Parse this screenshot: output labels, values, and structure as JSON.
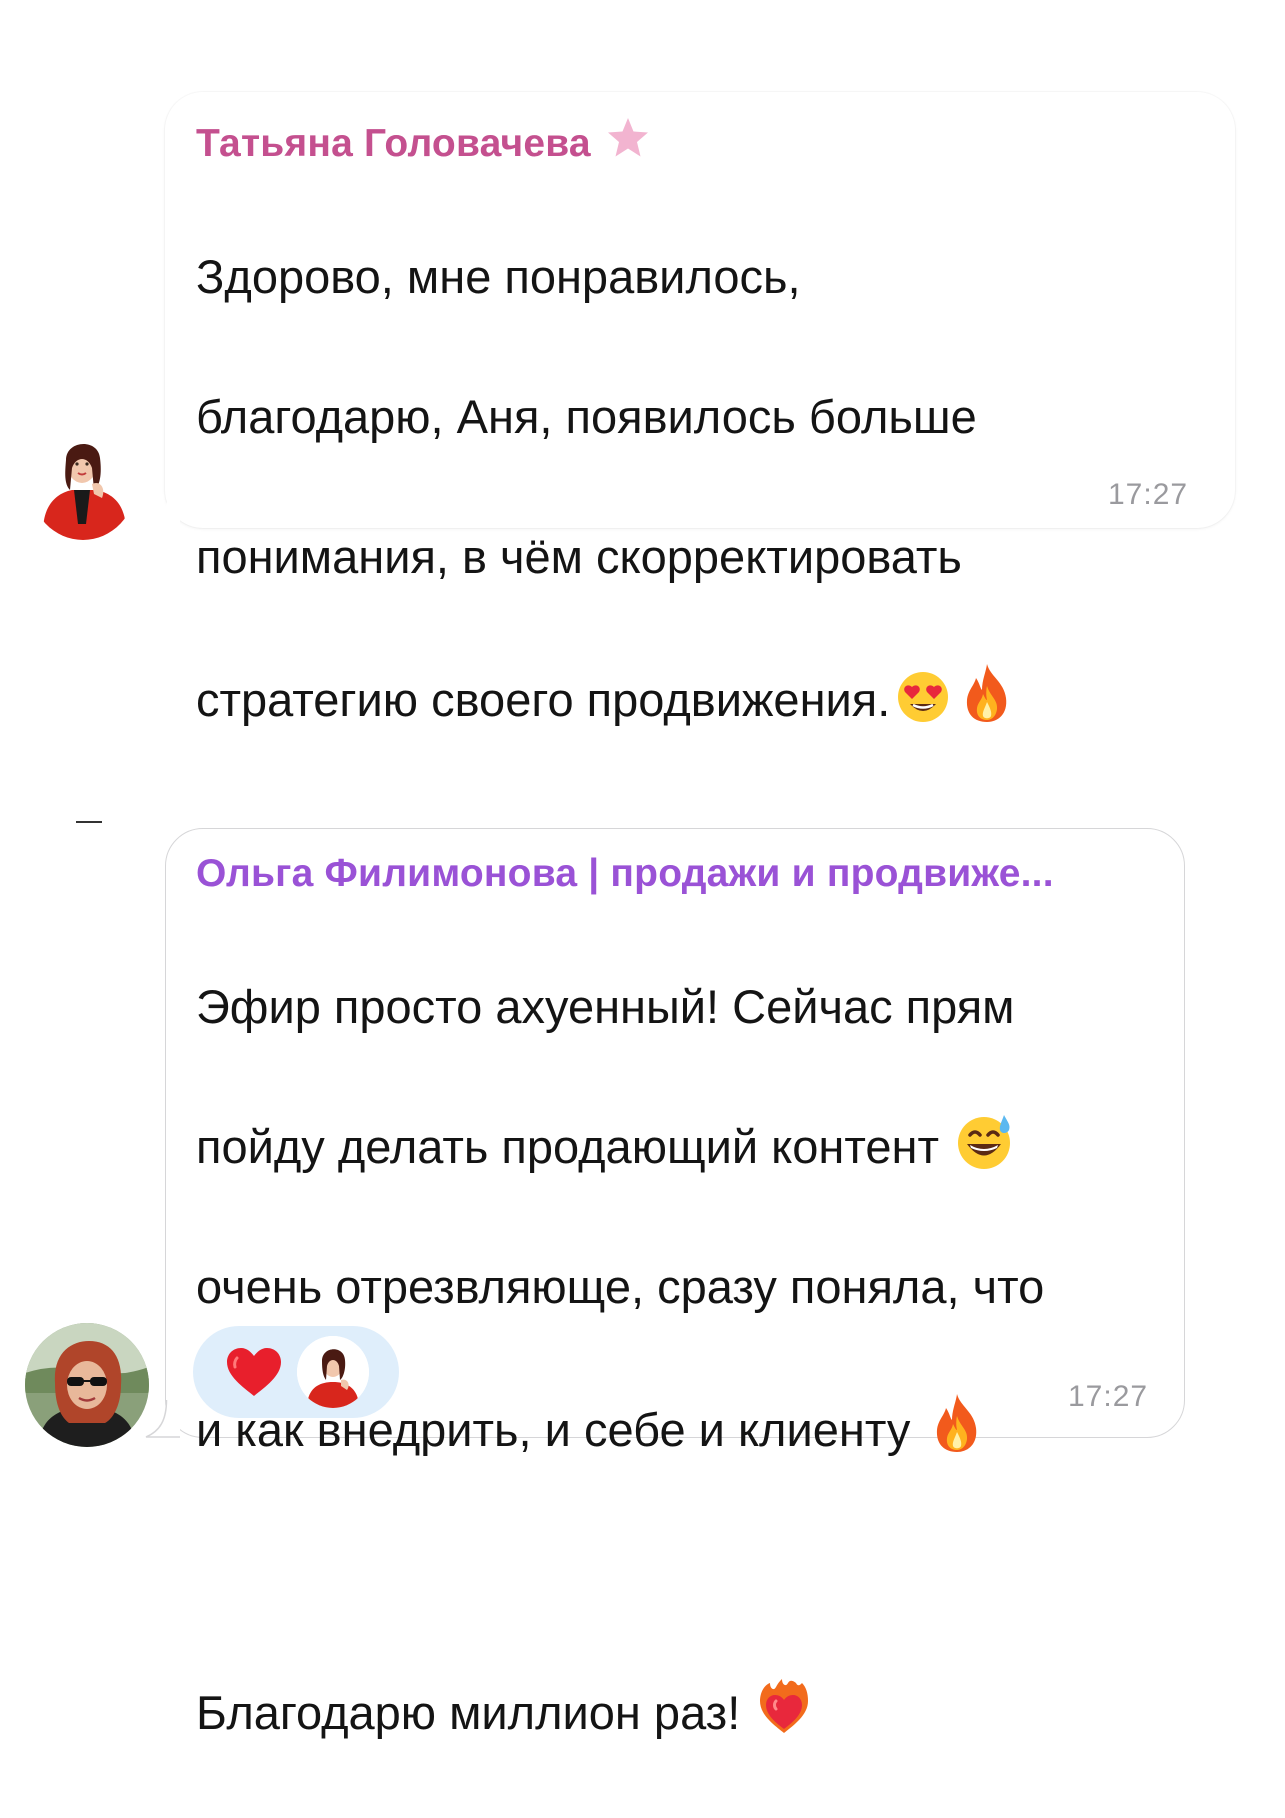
{
  "messages": [
    {
      "sender": "Татьяна Головачева",
      "sender_color": "#c4508f",
      "badge_icon": "star-icon",
      "text_lines": [
        "Здорово, мне понравилось,",
        "благодарю, Аня, появилось больше",
        "понимания, в чём скорректировать",
        "стратегию своего продвижения."
      ],
      "text_emoji": [
        "heart-eyes-emoji",
        "fire-emoji"
      ],
      "time": "17:27"
    },
    {
      "sender": "Ольга Филимонова | продажи и продвиже...",
      "sender_color": "#9a52d6",
      "text_lines": [
        "Эфир просто ахуенный! Сейчас прям",
        "пойду делать продающий контент",
        "очень отрезвляюще, сразу поняла, что",
        "и как внедрить, и себе и клиенту"
      ],
      "text_tail": "Благодарю миллион раз!",
      "text_emoji": [
        "grinning-sweat-emoji",
        "fire-emoji",
        "heart-on-fire-emoji"
      ],
      "reactions": [
        {
          "icon": "red-heart-icon"
        }
      ],
      "time": "17:27"
    }
  ],
  "colors": {
    "reaction_bg": "#dfeefb",
    "timestamp": "#9a9a9e",
    "bubble_border": "#d6d6d8"
  }
}
